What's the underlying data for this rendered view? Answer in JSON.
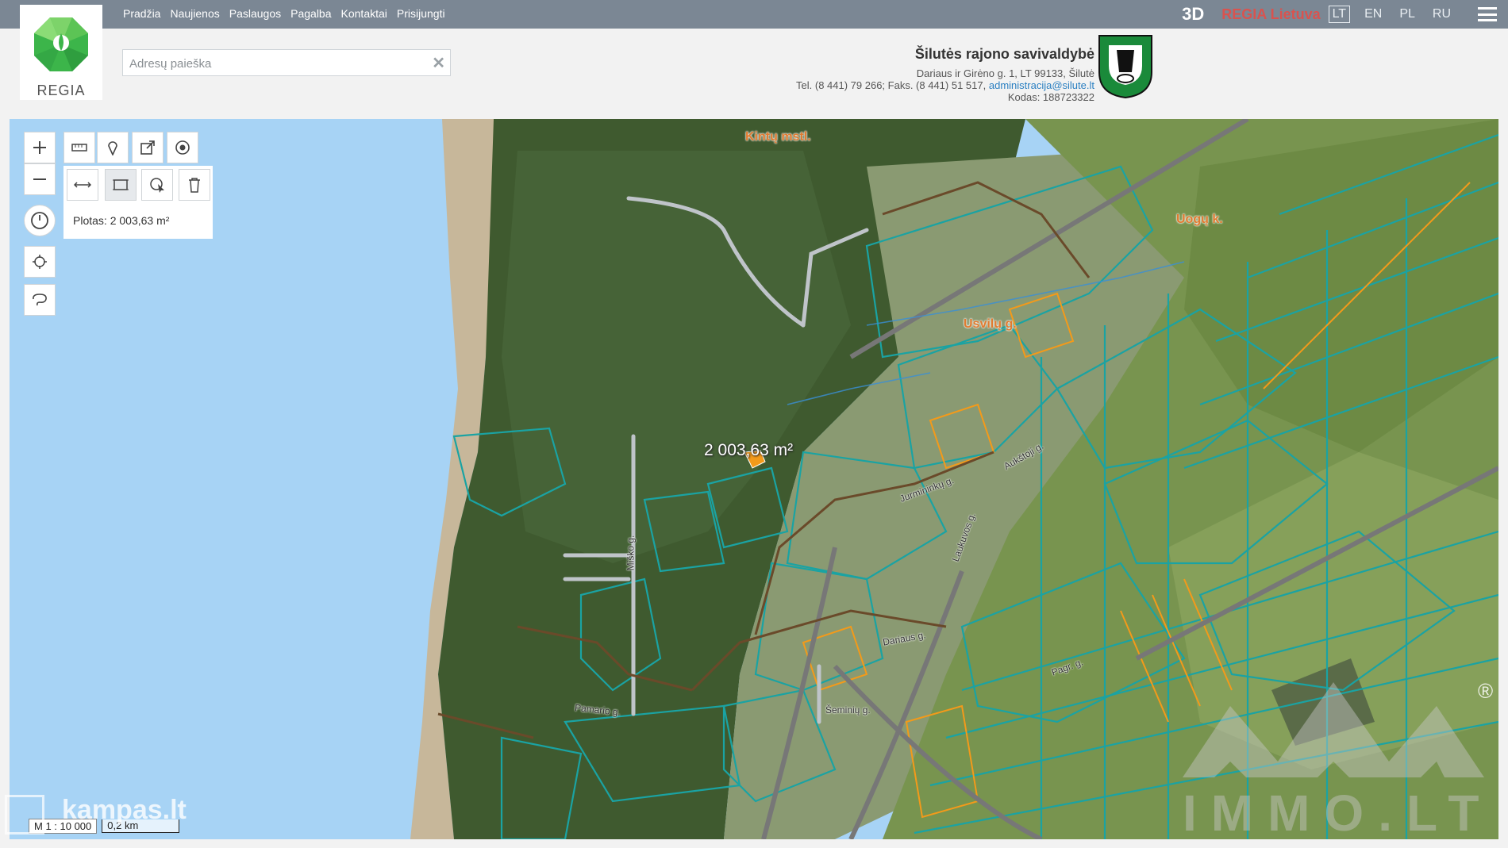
{
  "nav": [
    "Pradžia",
    "Naujienos",
    "Paslaugos",
    "Pagalba",
    "Kontaktai",
    "Prisijungti"
  ],
  "topright": {
    "btn3d": "3D",
    "regia_lietuva": "REGIA Lietuva",
    "languages": [
      "LT",
      "EN",
      "PL",
      "RU"
    ],
    "active_language": "LT"
  },
  "logo": {
    "text": "REGIA"
  },
  "search": {
    "placeholder": "Adresų paieška",
    "clear_symbol": "✕"
  },
  "municipality": {
    "title": "Šilutės rajono savivaldybė",
    "address": "Dariaus ir Girėno g. 1, LT 99133, Šilutė",
    "phone": "Tel. (8 441) 79 266; Faks. (8 441) 51 517,",
    "email": "administracija@silute.lt",
    "code": "Kodas: 188723322"
  },
  "tools": {
    "row1": [
      "zoom-in-icon",
      "ruler-icon",
      "marker-icon",
      "export-icon",
      "target-icon"
    ],
    "row2": [
      "zoom-out-icon",
      "measure-distance-icon",
      "measure-area-icon",
      "select-icon",
      "trash-icon"
    ],
    "side": [
      "history-icon",
      "locate-icon",
      "lasso-icon"
    ]
  },
  "measurement": {
    "label": "Plotas: 2 003,63 m²",
    "map_label": "2 003,63 m²"
  },
  "map_labels": {
    "kintu": "Kintų mstl.",
    "uogu": "Uogų k.",
    "usvilu": "Usvilų g.",
    "aukstoji": "Aukštoji g.",
    "jurminu": "Jurmininkų g.",
    "misko": "Miško g.",
    "pamario": "Pamario g.",
    "semininku": "Šeminių g.",
    "laukuvos": "Laukuvos g.",
    "dariaus": "Dariaus g.",
    "pagrynys": "Pagr. g."
  },
  "scale": {
    "ratio": "M 1 : 10 000",
    "bar": "0,2 km"
  },
  "watermarks": {
    "kampas": "kampas.lt",
    "immo": "IMMO.LT",
    "registered": "®"
  }
}
